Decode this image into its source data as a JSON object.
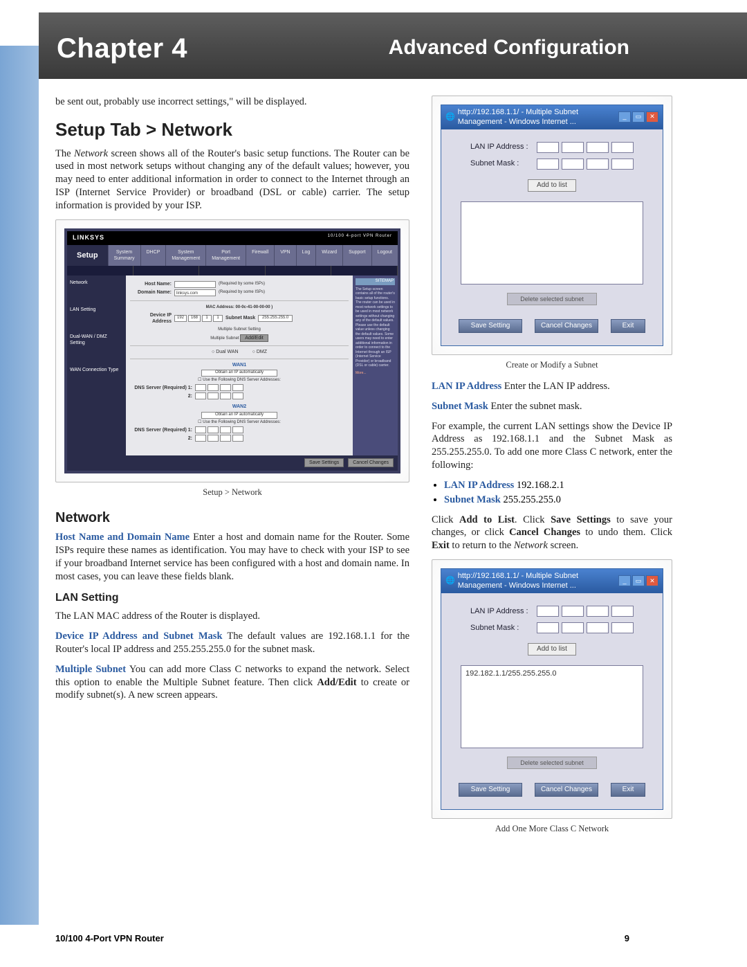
{
  "header": {
    "chapter": "Chapter 4",
    "title": "Advanced Configuration"
  },
  "col1": {
    "intro": "be sent out, probably use incorrect settings,\" will be displayed.",
    "h_setup": "Setup Tab > Network",
    "p_setup": "The Network screen shows all of the Router's basic setup functions. The Router can be used in most network setups without changing any of the default values; however, you may need to enter additional information in order to connect to the Internet through an ISP (Internet Service Provider) or broadband (DSL or cable) carrier. The setup information is provided by your ISP.",
    "router": {
      "logo": "LINKSYS",
      "model": "10/100 4-port VPN Router",
      "tab_setup": "Setup",
      "tabs": [
        "System Summary",
        "DHCP",
        "System Management",
        "Port Management",
        "Firewall",
        "VPN",
        "Log",
        "Wizard",
        "Support",
        "Logout"
      ],
      "side": [
        "Network",
        "LAN Setting",
        "Dual-WAN / DMZ Setting",
        "WAN Connection Type"
      ],
      "hostname": "Host Name:",
      "hostnote": "(Required by some ISPs)",
      "domainname": "Domain Name:",
      "domainval": "linksys.com",
      "domainnote": "(Required by some ISPs)",
      "mac": "MAC Address: 00-0c-41-00-00-00 )",
      "devip": "Device IP Address",
      "submask": "Subnet Mask",
      "submaskval": "255.255.255.0",
      "multi": "Multiple Subnet Setting",
      "multibtn": "Add/Edit",
      "dualwan": "Dual WAN",
      "dmz": "DMZ",
      "wan1": "WAN1",
      "obtain": "Obtain an IP automatically",
      "dnschk": "Use the Following DNS Server Addresses:",
      "dnssrv": "DNS Server (Required) 1:",
      "wan2": "WAN2",
      "savebtn": "Save Settings",
      "cancelbtn": "Cancel Changes",
      "help_hdr": "SITEMAP",
      "help_body": "The Setup screen contains all of the router's basic setup functions. The router can be used in most network settings to be used in most network settings without changing any of the default values. Please use the default value unless changing the default values. Some users may need to enter additional information in order to connect to the Internet through an ISP (Internet Service Provider) or broadband (DSL or cable) carrier."
    },
    "caption1": "Setup > Network",
    "h_network": "Network",
    "bold_host": "Host Name and Domain Name",
    "p_host": "  Enter a host and domain name for the Router. Some ISPs require these names as identification. You may have to check with your ISP to see if your broadband Internet service has been configured with a host and domain name. In most cases, you can leave these fields blank.",
    "h_lan": "LAN Setting",
    "p_lan": "The LAN MAC address of the Router is displayed.",
    "bold_devip": "Device IP Address and Subnet Mask",
    "p_devip": "  The default values are 192.168.1.1 for the Router's local IP address and 255.255.255.0 for the subnet mask.",
    "bold_multi": "Multiple Subnet",
    "p_multi": "  You can add more Class C networks to expand the network. Select this option to enable the Multiple Subnet feature. Then click Add/Edit to create or modify subnet(s). A new screen appears."
  },
  "col2": {
    "ie": {
      "title": "http://192.168.1.1/ - Multiple Subnet Management - Windows Internet ...",
      "lanip": "LAN IP Address :",
      "mask": "Subnet Mask :",
      "add": "Add to list",
      "entry": "192.182.1.1/255.255.255.0",
      "del": "Delete selected subnet",
      "save": "Save Setting",
      "cancel": "Cancel Changes",
      "exit": "Exit"
    },
    "caption2": "Create or Modify a Subnet",
    "bold_lanip": "LAN IP Address",
    "p_lanip": "  Enter the LAN IP address.",
    "bold_mask": "Subnet Mask",
    "p_mask": "  Enter the subnet mask.",
    "p_example": "For example, the current LAN settings show the Device IP Address as 192.168.1.1 and the Subnet Mask as 255.255.255.0. To add one more Class C network, enter the following:",
    "bullet1_label": "LAN IP Address",
    "bullet1_val": "  192.168.2.1",
    "bullet2_label": "Subnet Mask",
    "bullet2_val": "  255.255.255.0",
    "p_click": "Click Add to List. Click Save Settings to save your changes, or click Cancel Changes to undo them. Click Exit to return to the Network screen.",
    "caption3": "Add One More Class C Network"
  },
  "footer": {
    "product": "10/100 4-Port VPN Router",
    "page": "9"
  }
}
